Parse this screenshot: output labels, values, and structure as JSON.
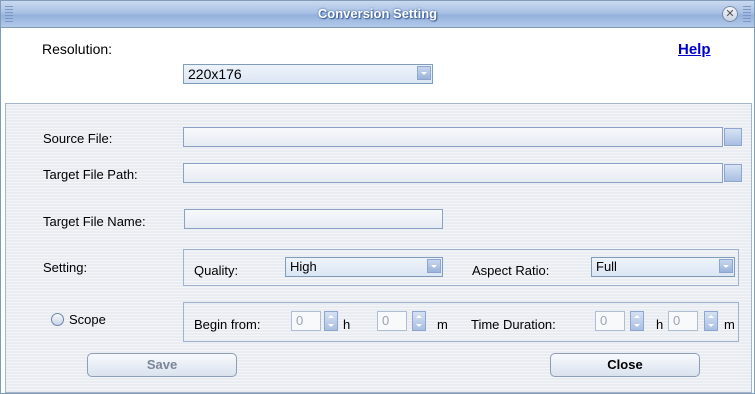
{
  "window": {
    "title": "Conversion Setting"
  },
  "top": {
    "resolution_label": "Resolution:",
    "resolution_value": "220x176",
    "help_label": "Help"
  },
  "form": {
    "source_file_label": "Source File:",
    "source_file_value": "",
    "target_path_label": "Target File Path:",
    "target_path_value": "",
    "target_name_label": "Target File Name:",
    "target_name_value": "",
    "setting_label": "Setting:",
    "quality_label": "Quality:",
    "quality_value": "High",
    "aspect_label": "Aspect Ratio:",
    "aspect_value": "Full",
    "scope_label": "Scope",
    "begin_label": "Begin from:",
    "begin_h_value": "0",
    "h_unit": "h",
    "begin_m_value": "0",
    "m_unit": "m",
    "duration_label": "Time Duration:",
    "duration_h_value": "0",
    "duration_m_value": "0"
  },
  "buttons": {
    "save_label": "Save",
    "close_label": "Close"
  }
}
